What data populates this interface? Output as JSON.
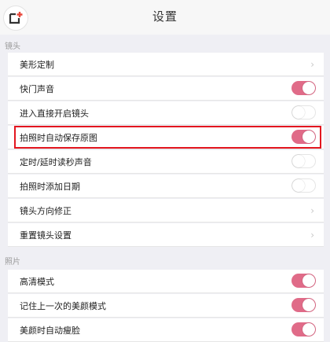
{
  "header": {
    "title": "设置",
    "app_icon": "camera-plus-icon"
  },
  "sections": {
    "camera": {
      "label": "镜头",
      "items": [
        {
          "label": "美形定制",
          "control": "chevron"
        },
        {
          "label": "快门声音",
          "control": "toggle",
          "on": true
        },
        {
          "label": "进入直接开启镜头",
          "control": "toggle",
          "on": false
        },
        {
          "label": "拍照时自动保存原图",
          "control": "toggle",
          "on": true,
          "highlighted": true
        },
        {
          "label": "定时/延时读秒声音",
          "control": "toggle",
          "on": false
        },
        {
          "label": "拍照时添加日期",
          "control": "toggle",
          "on": false
        },
        {
          "label": "镜头方向修正",
          "control": "chevron"
        },
        {
          "label": "重置镜头设置",
          "control": "chevron"
        }
      ]
    },
    "photo": {
      "label": "照片",
      "items": [
        {
          "label": "高清模式",
          "control": "toggle",
          "on": true
        },
        {
          "label": "记住上一次的美颜模式",
          "control": "toggle",
          "on": true
        },
        {
          "label": "美颜时自动瘦脸",
          "control": "toggle",
          "on": true
        }
      ]
    }
  },
  "colors": {
    "toggle_on": "#e06b88",
    "highlight_border": "#e3161f",
    "background": "#efeff4"
  }
}
